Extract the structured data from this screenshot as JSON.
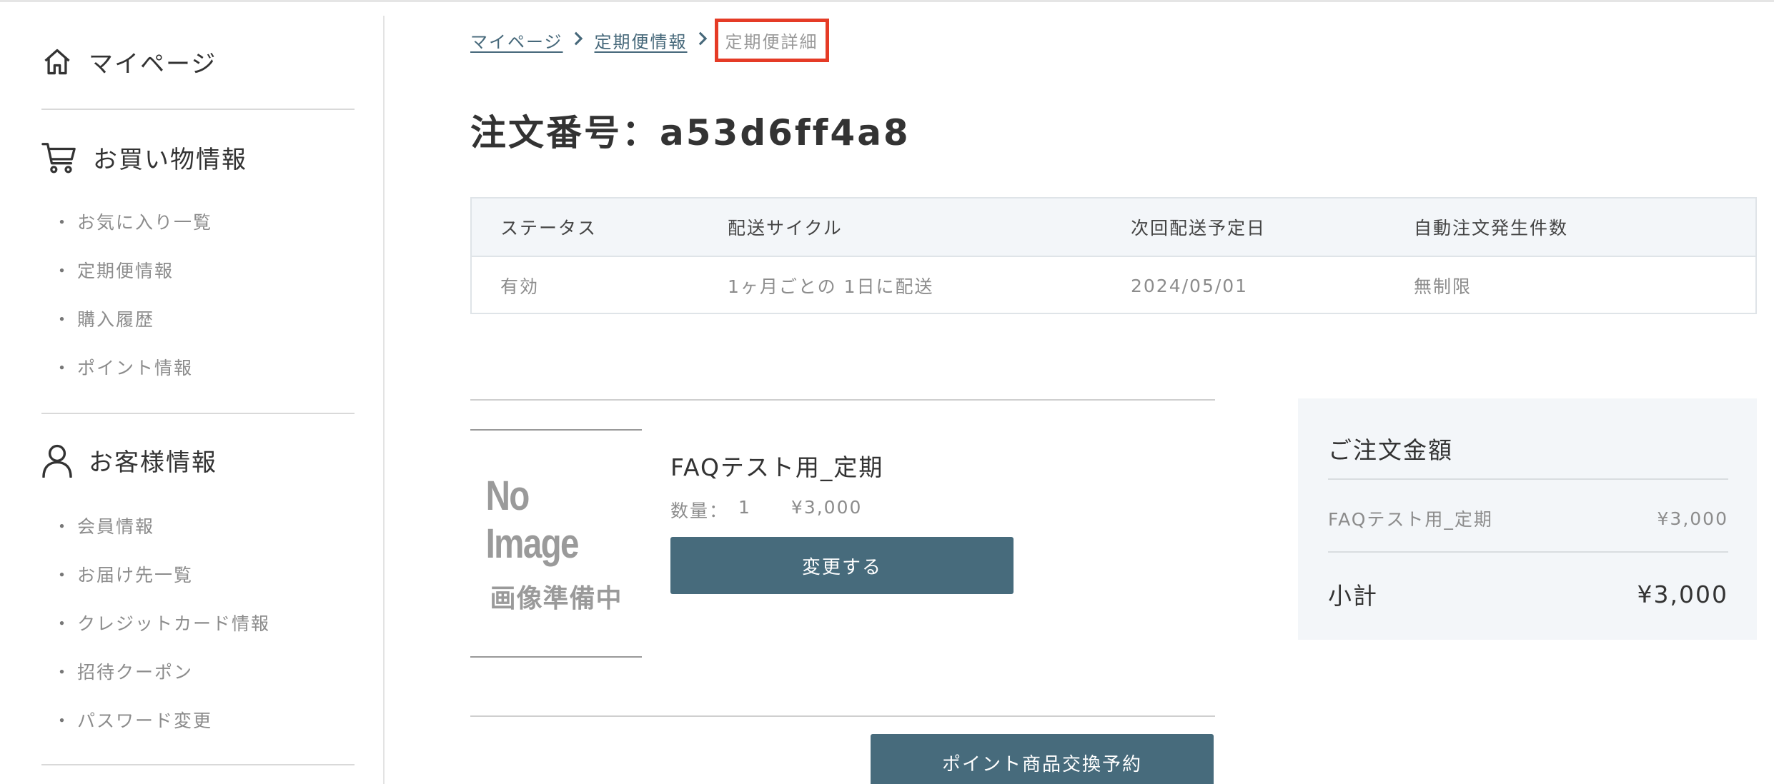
{
  "sidebar": {
    "mypage": {
      "label": "マイページ",
      "icon": "home-icon"
    },
    "shopping": {
      "title": "お買い物情報",
      "icon": "cart-icon",
      "items": [
        "お気に入り一覧",
        "定期便情報",
        "購入履歴",
        "ポイント情報"
      ]
    },
    "customer": {
      "title": "お客様情報",
      "icon": "user-icon",
      "items": [
        "会員情報",
        "お届け先一覧",
        "クレジットカード情報",
        "招待クーポン",
        "パスワード変更"
      ]
    }
  },
  "breadcrumb": {
    "items": [
      "マイページ",
      "定期便情報"
    ],
    "current": "定期便詳細",
    "highlight_color": "#e53b26"
  },
  "order": {
    "title": "注文番号：a53d6ff4a8"
  },
  "status_table": {
    "headers": [
      "ステータス",
      "配送サイクル",
      "次回配送予定日",
      "自動注文発生件数"
    ],
    "values": [
      "有効",
      "1ヶ月ごとの 1日に配送",
      "2024/05/01",
      "無制限"
    ]
  },
  "item": {
    "image_en": "No Image",
    "image_ja": "画像準備中",
    "name": "FAQテスト用_定期",
    "qty_label": "数量：",
    "qty": "1",
    "price": "¥3,000",
    "change_button": "変更する"
  },
  "point_button": "ポイント商品交換予約",
  "summary": {
    "title": "ご注文金額",
    "item_name": "FAQテスト用_定期",
    "item_price": "¥3,000",
    "subtotal_label": "小計",
    "subtotal": "¥3,000"
  },
  "colors": {
    "accent": "#476b7c",
    "panel": "#f3f6f9",
    "link": "#46687a"
  }
}
